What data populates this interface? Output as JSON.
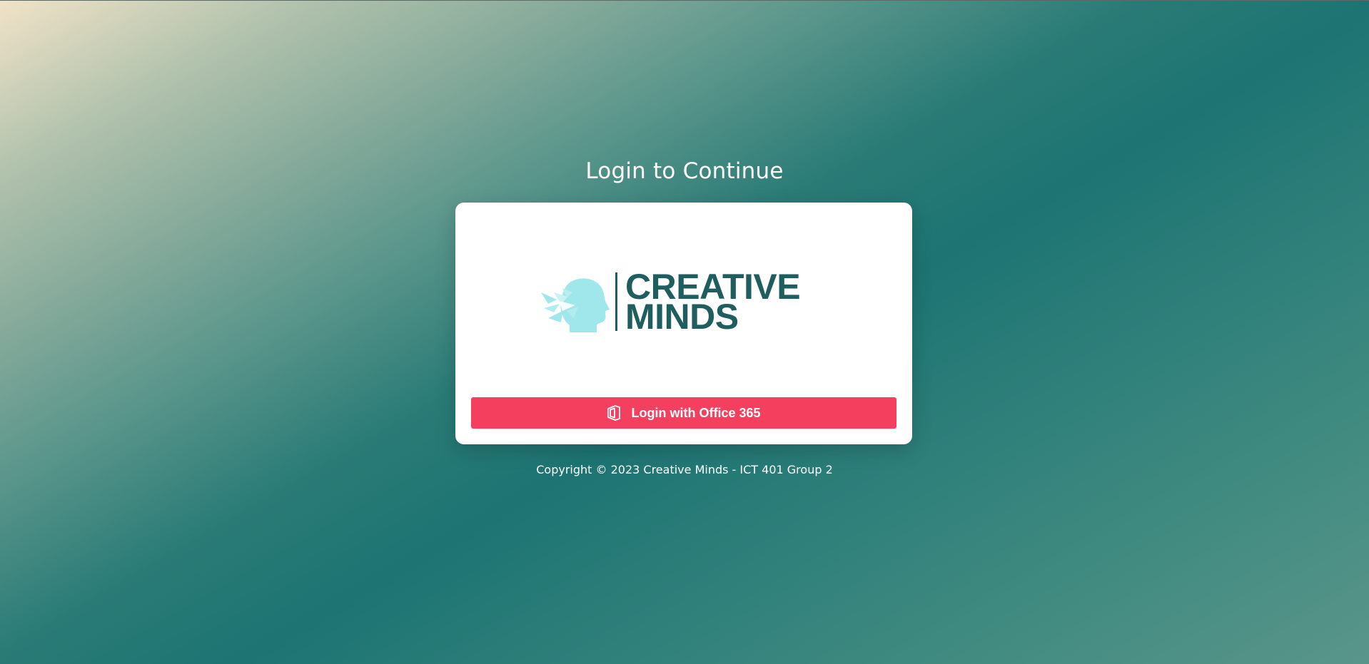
{
  "page": {
    "title": "Login to Continue",
    "footer": "Copyright © 2023 Creative Minds - ICT 401 Group 2"
  },
  "logo": {
    "line1": "CREATIVE",
    "line2": "MINDS",
    "icon": "head-origami-icon",
    "colors": {
      "text": "#1f5e5f",
      "icon": "#9be6ea"
    }
  },
  "login": {
    "button_label": "Login with Office 365",
    "icon": "office-365-icon",
    "color": "#f43f5e"
  }
}
